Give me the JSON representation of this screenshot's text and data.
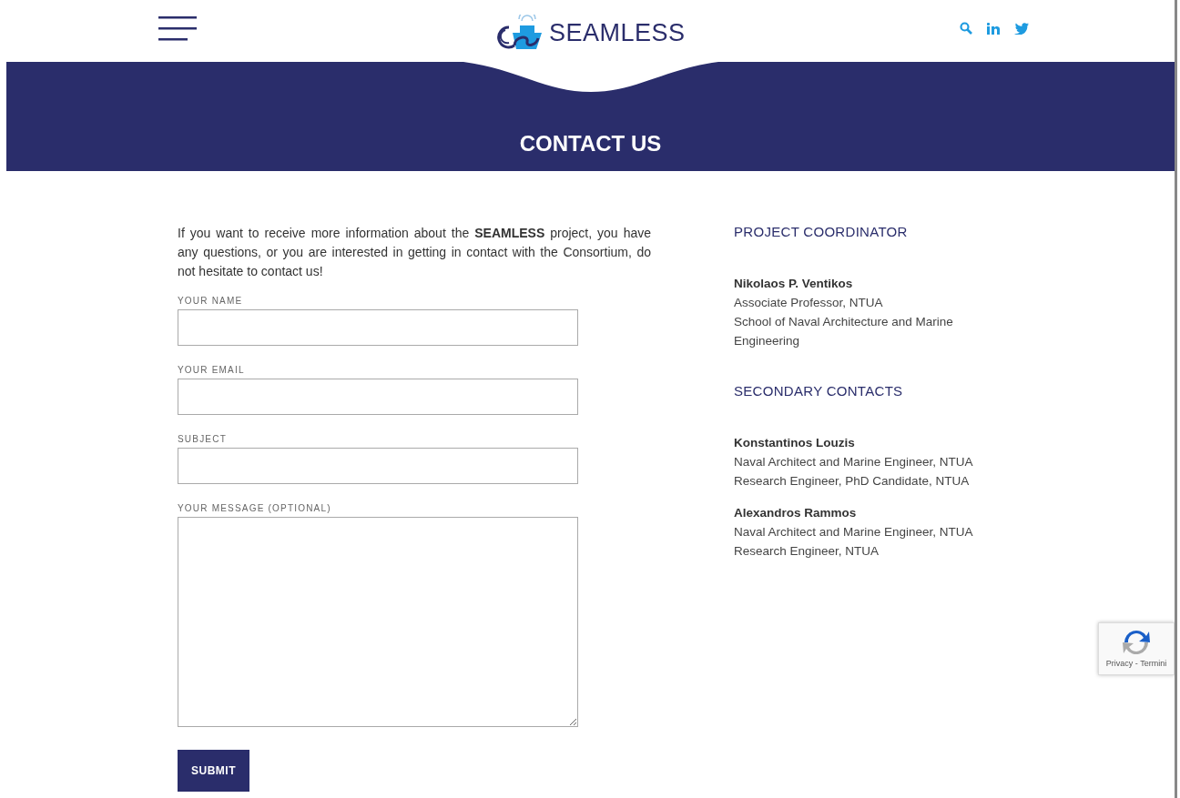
{
  "header": {
    "logo_text": "SEAMLESS"
  },
  "banner": {
    "title": "CONTACT US"
  },
  "intro": "If you want to receive more information about the **SEAMLESS** project, you have any questions, or you are interested in getting in contact with the Consortium, do not hesitate to contact us!",
  "form": {
    "fields": [
      {
        "label": "YOUR NAME",
        "kind": "input"
      },
      {
        "label": "YOUR EMAIL",
        "kind": "input"
      },
      {
        "label": "SUBJECT",
        "kind": "input"
      },
      {
        "label": "YOUR MESSAGE (OPTIONAL)",
        "kind": "textarea"
      }
    ],
    "submit": "SUBMIT"
  },
  "sections": [
    {
      "heading": "PROJECT COORDINATOR",
      "contacts": [
        {
          "name": "Nikolaos P. Ventikos",
          "lines": [
            "Associate Professor, NTUA",
            "School of Naval Architecture and Marine Engineering"
          ]
        }
      ]
    },
    {
      "heading": "SECONDARY CONTACTS",
      "contacts": [
        {
          "name": "Konstantinos Louzis",
          "lines": [
            "Naval Architect and Marine Engineer, NTUA",
            "Research Engineer, PhD Candidate, NTUA"
          ]
        },
        {
          "name": "Alexandros Rammos",
          "lines": [
            "Naval Architect and Marine Engineer, NTUA",
            "Research Engineer, NTUA"
          ]
        }
      ]
    }
  ],
  "recaptcha": {
    "text": "Privacy - Termini"
  }
}
